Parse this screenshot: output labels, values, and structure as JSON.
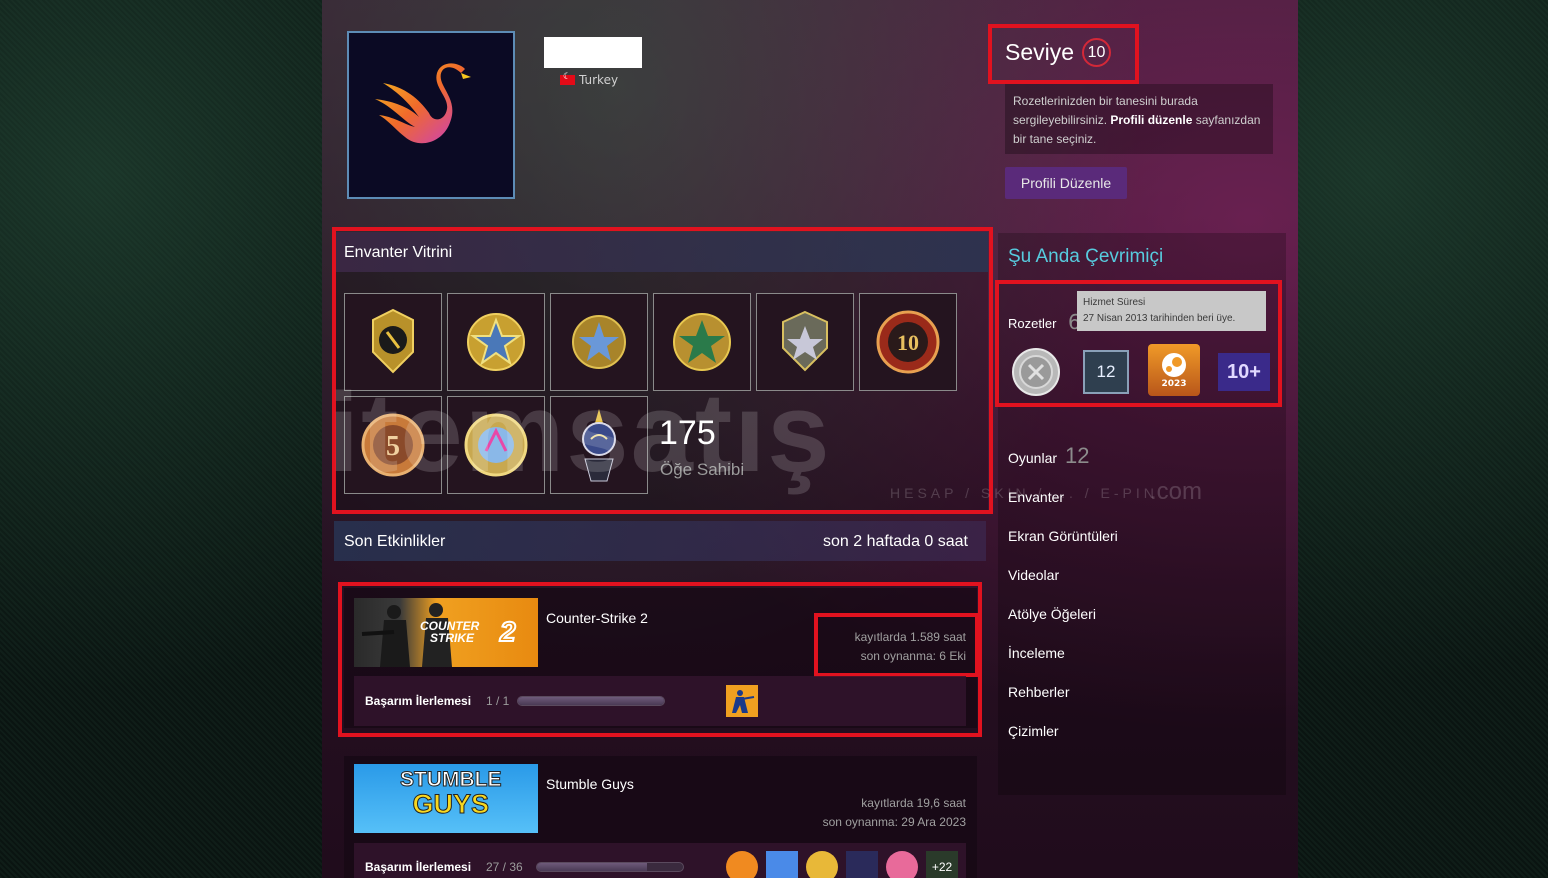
{
  "profile": {
    "country": "Turkey",
    "level_label": "Seviye",
    "level_value": "10"
  },
  "badge_info": {
    "text_before": "Rozetlerinizden bir tanesini burada sergileyebilirsiniz. ",
    "link": "Profili düzenle",
    "text_after": " sayfanızdan bir tane seçiniz."
  },
  "edit_button": "Profili Düzenle",
  "inventory": {
    "title": "Envanter Vitrini",
    "item_count": "175",
    "item_label": "Öğe Sahibi"
  },
  "watermark": {
    "main": "itemsatış",
    "sub": "HESAP / SKIN / ... / E-PIN",
    "com": ".com"
  },
  "sidebar": {
    "online_status": "Şu Anda Çevrimiçi",
    "badges_label": "Rozetler",
    "badges_count": "6",
    "tooltip_title": "Hizmet Süresi",
    "tooltip_text": "27 Nisan 2013 tarihinden beri üye.",
    "badge_years": "12",
    "badge_steam_year": "2023",
    "badge_level": "10+",
    "games_label": "Oyunlar",
    "games_count": "12",
    "links": [
      "Envanter",
      "Ekran Görüntüleri",
      "Videolar",
      "Atölye Öğeleri",
      "İnceleme",
      "Rehberler",
      "Çizimler"
    ]
  },
  "activity": {
    "title": "Son Etkinlikler",
    "hours": "son 2 haftada 0 saat",
    "games": [
      {
        "name": "Counter-Strike 2",
        "hours": "kayıtlarda 1.589 saat",
        "last_played": "son oynanma: 6 Eki",
        "ach_label": "Başarım İlerlemesi",
        "ach_count": "1 / 1",
        "ach_progress": 1.0,
        "thumb_text_1": "COUNTER",
        "thumb_text_2": "STRIKE",
        "thumb_text_3": "2"
      },
      {
        "name": "Stumble Guys",
        "hours": "kayıtlarda 19,6 saat",
        "last_played": "son oynanma: 29 Ara 2023",
        "ach_label": "Başarım İlerlemesi",
        "ach_count": "27 / 36",
        "ach_progress": 0.75,
        "more": "+22",
        "thumb_text_1": "STUMBLE",
        "thumb_text_2": "GUYS"
      }
    ]
  },
  "colors": {
    "accent_red": "#e1121f",
    "online_blue": "#57cbde",
    "button_purple": "#5a2a7a"
  }
}
